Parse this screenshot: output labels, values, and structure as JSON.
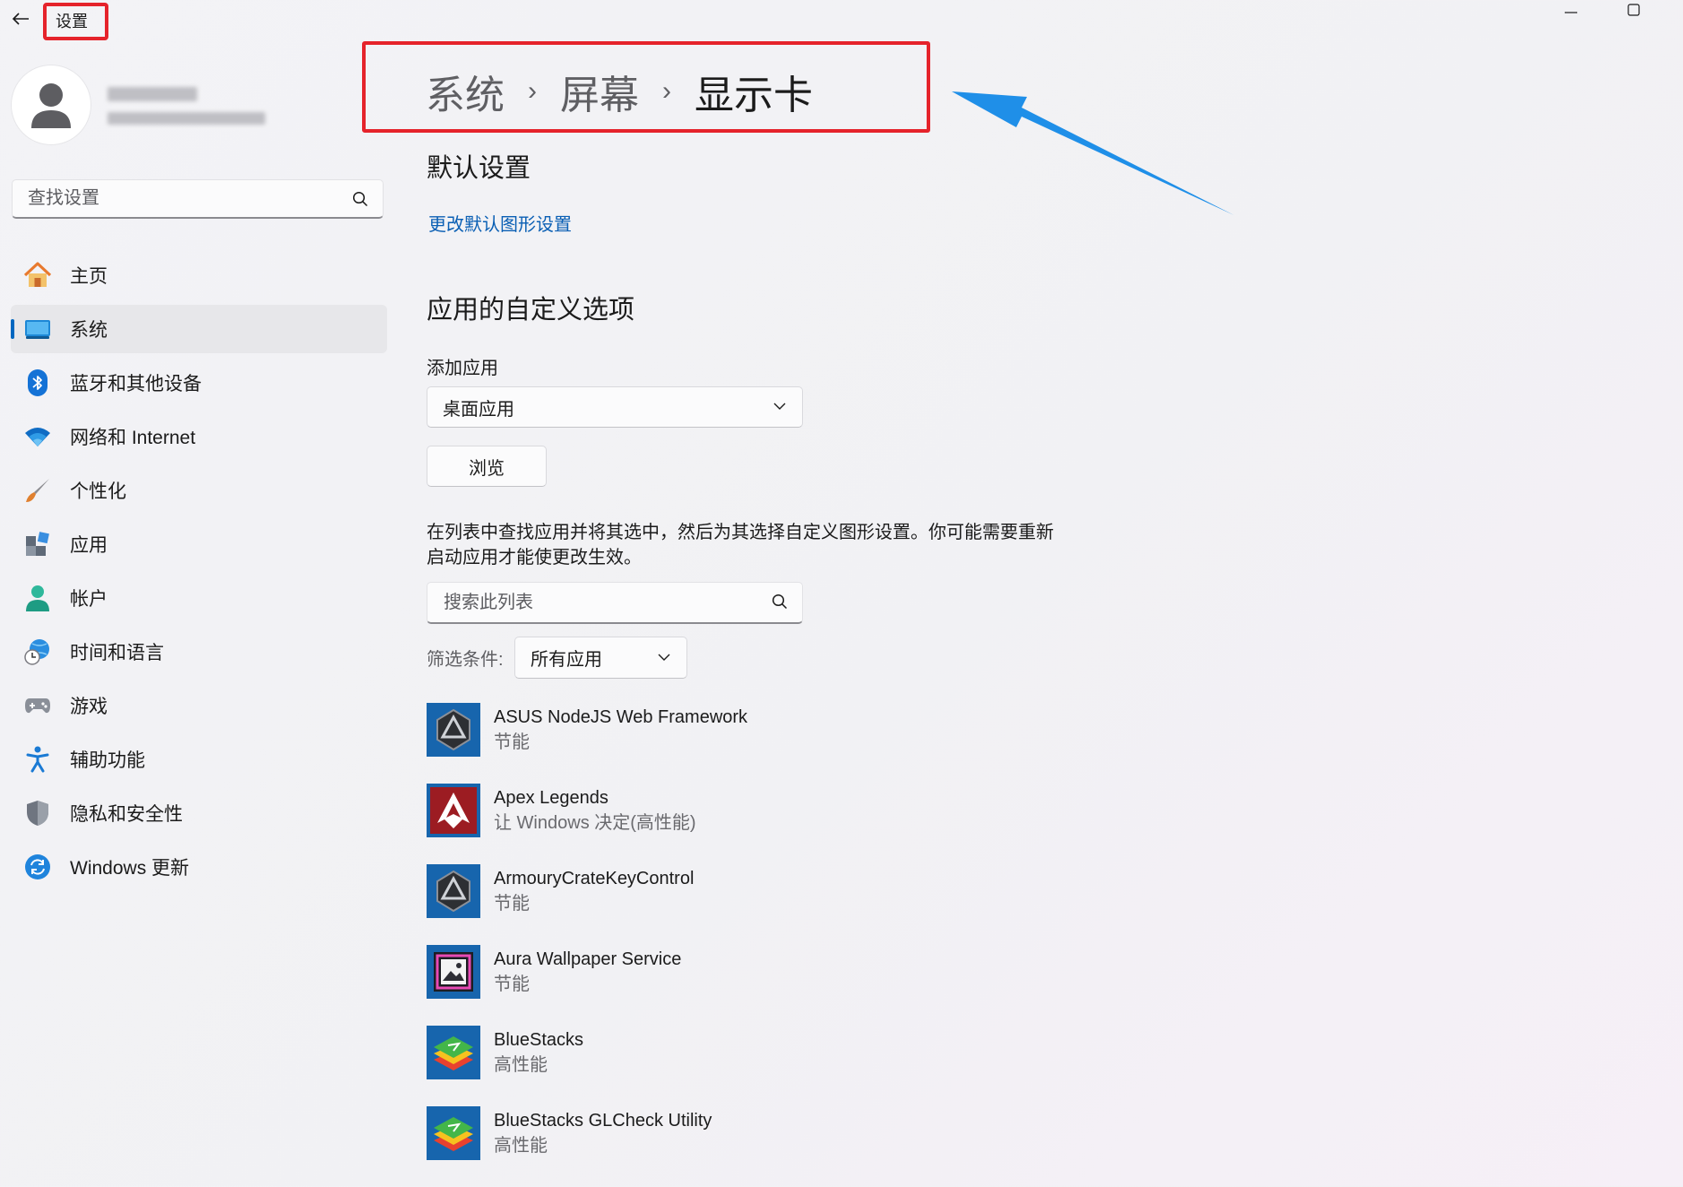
{
  "window": {
    "title": "设置"
  },
  "search": {
    "placeholder": "查找设置"
  },
  "nav": {
    "items": [
      {
        "label": "主页",
        "icon": "home-icon"
      },
      {
        "label": "系统",
        "icon": "system-display-icon",
        "selected": true
      },
      {
        "label": "蓝牙和其他设备",
        "icon": "bluetooth-icon"
      },
      {
        "label": "网络和 Internet",
        "icon": "wifi-icon"
      },
      {
        "label": "个性化",
        "icon": "brush-icon"
      },
      {
        "label": "应用",
        "icon": "apps-icon"
      },
      {
        "label": "帐户",
        "icon": "account-icon"
      },
      {
        "label": "时间和语言",
        "icon": "time-language-icon"
      },
      {
        "label": "游戏",
        "icon": "gamepad-icon"
      },
      {
        "label": "辅助功能",
        "icon": "accessibility-icon"
      },
      {
        "label": "隐私和安全性",
        "icon": "shield-icon"
      },
      {
        "label": "Windows 更新",
        "icon": "windows-update-icon"
      }
    ]
  },
  "breadcrumb": {
    "level1": "系统",
    "level2": "屏幕",
    "current": "显示卡"
  },
  "defaults": {
    "heading": "默认设置",
    "link": "更改默认图形设置"
  },
  "custom": {
    "heading": "应用的自定义选项",
    "add_label": "添加应用",
    "app_type_selected": "桌面应用",
    "browse_label": "浏览",
    "description": "在列表中查找应用并将其选中，然后为其选择自定义图形设置。你可能需要重新启动应用才能使更改生效。",
    "list_search_placeholder": "搜索此列表",
    "filter_label": "筛选条件:",
    "filter_selected": "所有应用"
  },
  "apps": [
    {
      "name": "ASUS NodeJS Web Framework",
      "pref": "节能",
      "icon": "asus-armoury-icon"
    },
    {
      "name": "Apex Legends",
      "pref": "让 Windows 决定(高性能)",
      "icon": "apex-legends-icon"
    },
    {
      "name": "ArmouryCrateKeyControl",
      "pref": "节能",
      "icon": "asus-armoury-icon"
    },
    {
      "name": "Aura Wallpaper Service",
      "pref": "节能",
      "icon": "aura-wallpaper-icon"
    },
    {
      "name": "BlueStacks",
      "pref": "高性能",
      "icon": "bluestacks-icon"
    },
    {
      "name": "BlueStacks GLCheck Utility",
      "pref": "高性能",
      "icon": "bluestacks-icon"
    }
  ],
  "colors": {
    "accent": "#0067c0",
    "link": "#0a5fb4",
    "highlight_red": "#e5232b",
    "arrow_blue": "#1f8fe8"
  }
}
